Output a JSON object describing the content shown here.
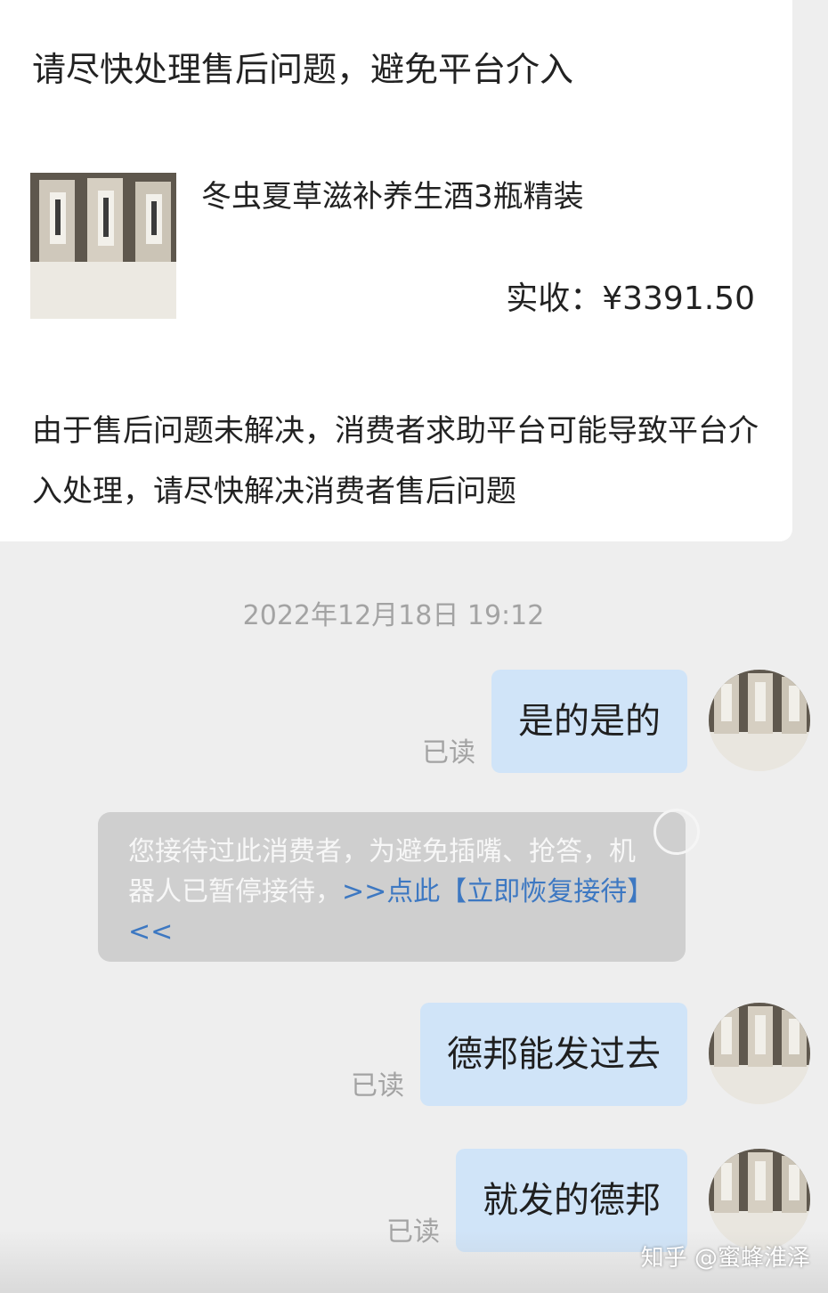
{
  "notice": {
    "title": "请尽快处理售后问题，避免平台介入",
    "product_name": "冬虫夏草滋补养生酒3瓶精装",
    "price_label": "实收：",
    "price_value": "¥3391.50",
    "body": "由于售后问题未解决，消费者求助平台可能导致平台介入处理，请尽快解决消费者售后问题"
  },
  "chat": {
    "timestamp": "2022年12月18日 19:12",
    "messages": [
      {
        "text": "是的是的",
        "status": "已读"
      },
      {
        "text": "德邦能发过去",
        "status": "已读"
      },
      {
        "text": "就发的德邦",
        "status": "已读"
      }
    ],
    "system_notice": {
      "text": "您接待过此消费者，为避免插嘴、抢答，机器人已暂停接待，",
      "link_text": ">>点此【立即恢复接待】<<"
    }
  },
  "watermark": "知乎 @蜜蜂淮泽",
  "colors": {
    "background": "#eeeeee",
    "card": "#ffffff",
    "bubble": "#d0e4f8",
    "link": "#3d78c2",
    "muted": "#a3a3a3"
  }
}
